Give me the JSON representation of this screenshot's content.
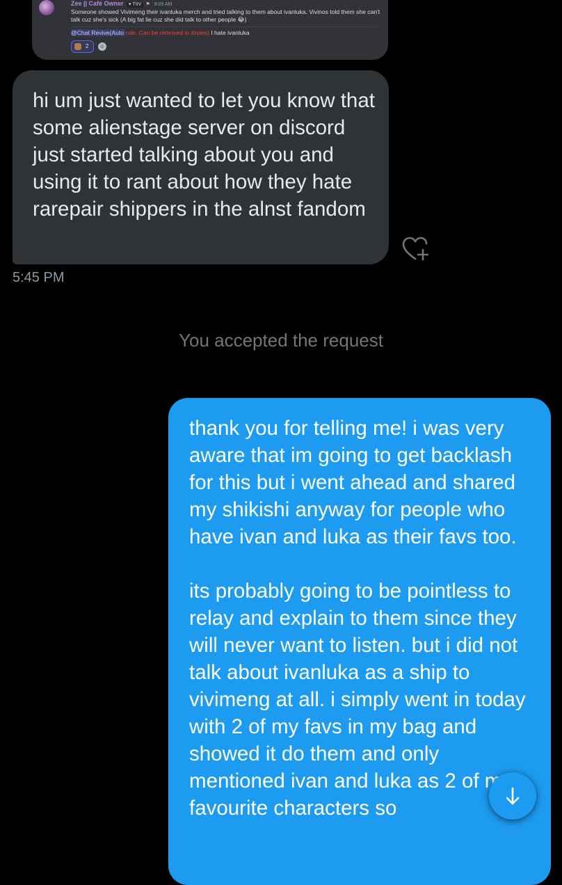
{
  "attachment": {
    "username": "Zee || Café Owner",
    "role_tag": "TIIV",
    "time": "9:09 AM",
    "text": "Someone showed Vivimeng their ivanluka merch and tried talking to them about ivanluka. Vivinos told them she can't talk cuz she's sick (A big fat lie cuz she did talk to other people 😂)",
    "mention_prefix": "@Chat Revive(Auto ",
    "mention_role": "role. Can be removed in #roles)",
    "mention_suffix": " I hate ivanluka",
    "reaction_count": "2"
  },
  "received_message": {
    "text": "hi um just wanted to let you know that some alienstage server on discord just started talking about you and using it to rant about how they hate rarepair shippers in the alnst fandom",
    "time": "5:45 PM",
    "like_icon": "heart-plus-icon"
  },
  "system_message": "You accepted the request",
  "sent_message": {
    "paragraph1": "thank you for telling me! i was very aware that im going to get backlash for this but i went ahead and shared my shikishi anyway for people who have ivan and luka as their favs too.",
    "paragraph2": "its probably going to be pointless to relay and explain to them since they will never want to listen. but i did not talk about ivanluka as a ship to vivimeng at all. i simply went in today with 2 of my favs in my bag and showed it do them and only mentioned ivan and luka as 2 of my favourite characters so"
  },
  "scroll_button_icon": "arrow-down-icon",
  "colors": {
    "background": "#000000",
    "received_bubble": "#2f3336",
    "sent_bubble": "#1d9bf0",
    "muted_text": "#71767b"
  }
}
